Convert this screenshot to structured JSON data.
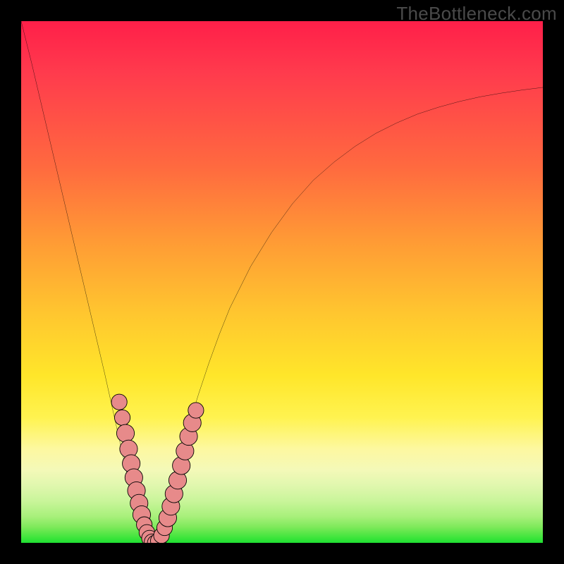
{
  "watermark": "TheBottleneck.com",
  "colors": {
    "curve": "#000000",
    "marker_fill": "#e78a8a",
    "marker_stroke": "#000000"
  },
  "chart_data": {
    "type": "line",
    "title": "",
    "xlabel": "",
    "ylabel": "",
    "xlim": [
      0,
      100
    ],
    "ylim": [
      0,
      100
    ],
    "grid": false,
    "series": [
      {
        "name": "bottleneck-curve",
        "x": [
          0,
          2,
          4,
          6,
          8,
          10,
          12,
          14,
          16,
          18,
          19,
          20,
          21,
          22,
          23,
          23.5,
          24,
          24.5,
          25,
          26,
          27,
          28,
          29,
          30,
          32,
          34,
          36,
          38,
          40,
          44,
          48,
          52,
          56,
          60,
          64,
          68,
          72,
          76,
          80,
          84,
          88,
          92,
          96,
          100
        ],
        "y": [
          100,
          92,
          83.5,
          75,
          66.5,
          58,
          49.5,
          41,
          32.5,
          23.5,
          19,
          14.5,
          10,
          6,
          3,
          1.6,
          0.7,
          0.2,
          0,
          1,
          3.5,
          7,
          11,
          15,
          22,
          28.5,
          34.5,
          40,
          45,
          53,
          59.5,
          65,
          69.5,
          73,
          76,
          78.5,
          80.5,
          82.2,
          83.5,
          84.6,
          85.5,
          86.2,
          86.8,
          87.3
        ]
      }
    ],
    "markers": [
      {
        "x": 18.8,
        "y": 27.0,
        "r": 1.5
      },
      {
        "x": 19.4,
        "y": 24.0,
        "r": 1.5
      },
      {
        "x": 20.0,
        "y": 21.0,
        "r": 1.7
      },
      {
        "x": 20.6,
        "y": 18.0,
        "r": 1.7
      },
      {
        "x": 21.1,
        "y": 15.2,
        "r": 1.7
      },
      {
        "x": 21.6,
        "y": 12.5,
        "r": 1.7
      },
      {
        "x": 22.1,
        "y": 10.0,
        "r": 1.7
      },
      {
        "x": 22.6,
        "y": 7.6,
        "r": 1.7
      },
      {
        "x": 23.1,
        "y": 5.4,
        "r": 1.7
      },
      {
        "x": 23.6,
        "y": 3.5,
        "r": 1.5
      },
      {
        "x": 24.1,
        "y": 2.0,
        "r": 1.5
      },
      {
        "x": 24.6,
        "y": 0.9,
        "r": 1.5
      },
      {
        "x": 25.1,
        "y": 0.2,
        "r": 1.5
      },
      {
        "x": 25.7,
        "y": 0.0,
        "r": 1.5
      },
      {
        "x": 26.3,
        "y": 0.4,
        "r": 1.5
      },
      {
        "x": 26.9,
        "y": 1.4,
        "r": 1.5
      },
      {
        "x": 27.5,
        "y": 2.9,
        "r": 1.5
      },
      {
        "x": 28.1,
        "y": 4.8,
        "r": 1.7
      },
      {
        "x": 28.7,
        "y": 7.0,
        "r": 1.7
      },
      {
        "x": 29.3,
        "y": 9.4,
        "r": 1.7
      },
      {
        "x": 30.0,
        "y": 12.0,
        "r": 1.7
      },
      {
        "x": 30.7,
        "y": 14.8,
        "r": 1.7
      },
      {
        "x": 31.4,
        "y": 17.6,
        "r": 1.7
      },
      {
        "x": 32.1,
        "y": 20.4,
        "r": 1.7
      },
      {
        "x": 32.8,
        "y": 23.0,
        "r": 1.7
      },
      {
        "x": 33.5,
        "y": 25.4,
        "r": 1.5
      }
    ]
  }
}
